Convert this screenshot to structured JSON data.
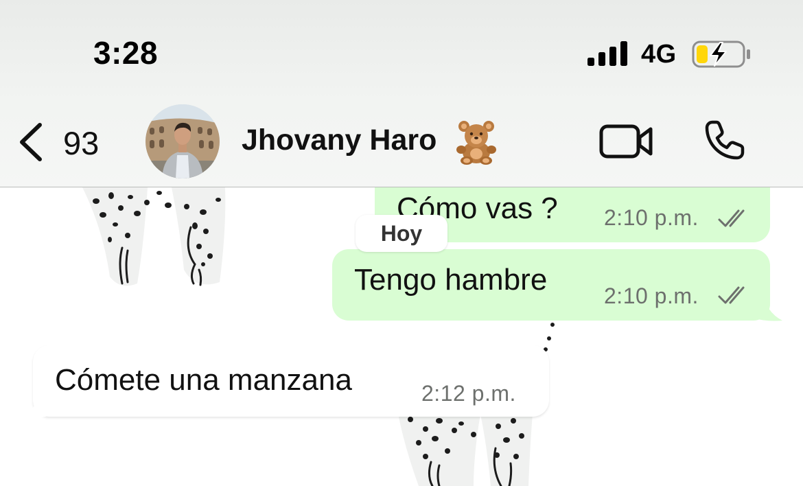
{
  "status_bar": {
    "time": "3:28",
    "network": "4G",
    "signal_bars": 4,
    "battery_charging": true,
    "battery_level": 0.2
  },
  "header": {
    "back_count": "93",
    "contact_name": "Jhovany Haro",
    "contact_emoji": "teddy-bear",
    "icons": [
      "chevron-left-icon",
      "video-camera-icon",
      "phone-icon"
    ]
  },
  "chat": {
    "date_separator": "Hoy",
    "messages": [
      {
        "direction": "outgoing",
        "text": "Cómo vas ?",
        "time": "2:10 p.m.",
        "status": "read"
      },
      {
        "direction": "outgoing",
        "text": "Tengo hambre",
        "time": "2:10 p.m.",
        "status": "read"
      },
      {
        "direction": "incoming",
        "text": "Cómete una manzana",
        "time": "2:12 p.m."
      }
    ]
  },
  "colors": {
    "outgoing_bubble": "#d9fdd3",
    "incoming_bubble": "#ffffff",
    "timestamp": "#6d706d",
    "battery_fill": "#ffd60a"
  }
}
